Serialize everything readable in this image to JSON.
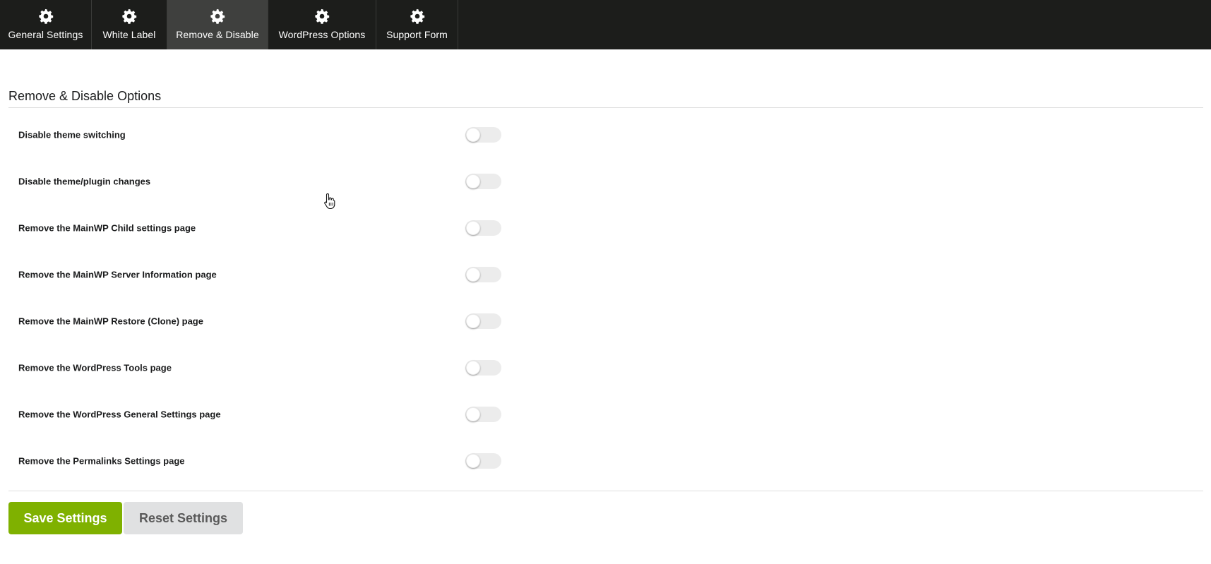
{
  "tabs": [
    {
      "label": "General Settings",
      "icon": "gear-icon",
      "active": false
    },
    {
      "label": "White Label",
      "icon": "gear-icon",
      "active": false
    },
    {
      "label": "Remove & Disable",
      "icon": "gear-icon",
      "active": true
    },
    {
      "label": "WordPress Options",
      "icon": "gear-icon",
      "active": false
    },
    {
      "label": "Support Form",
      "icon": "gear-icon",
      "active": false
    }
  ],
  "section": {
    "title": "Remove & Disable Options"
  },
  "options": [
    {
      "label": "Disable theme switching",
      "enabled": false
    },
    {
      "label": "Disable theme/plugin changes",
      "enabled": false
    },
    {
      "label": "Remove the MainWP Child settings page",
      "enabled": false
    },
    {
      "label": "Remove the MainWP Server Information page",
      "enabled": false
    },
    {
      "label": "Remove the MainWP Restore (Clone) page",
      "enabled": false
    },
    {
      "label": "Remove the WordPress Tools page",
      "enabled": false
    },
    {
      "label": "Remove the WordPress General Settings page",
      "enabled": false
    },
    {
      "label": "Remove the Permalinks Settings page",
      "enabled": false
    }
  ],
  "buttons": {
    "save_label": "Save Settings",
    "reset_label": "Reset Settings"
  },
  "colors": {
    "tabbar_bg": "#1c1d1b",
    "tab_active_bg": "#3f403e",
    "save_bg": "#7fb100",
    "reset_bg": "#e0e1e2",
    "toggle_off_bg": "#ececec"
  }
}
